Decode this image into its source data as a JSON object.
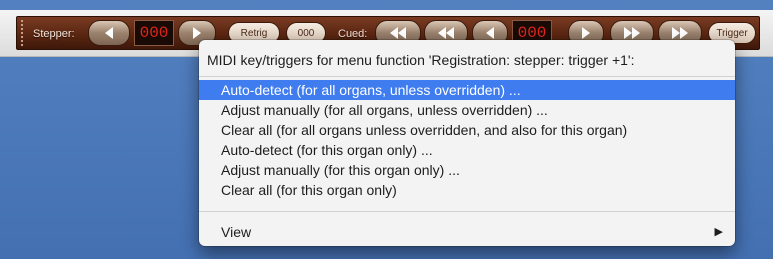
{
  "toolbar": {
    "stepper_label": "Stepper:",
    "stepper_counter": "000",
    "retrig_label": "Retrig",
    "count_label": "000",
    "cued_label": "Cued:",
    "cued_counter": "000",
    "trigger_label": "Trigger"
  },
  "menu": {
    "header": "MIDI key/triggers for menu function 'Registration: stepper: trigger +1':",
    "items": [
      {
        "label": "Auto-detect (for all organs, unless overridden) ..."
      },
      {
        "label": "Adjust manually (for all organs, unless overridden) ..."
      },
      {
        "label": "Clear all (for all organs unless overridden, and also for this organ)"
      },
      {
        "label": "Auto-detect (for this organ only) ..."
      },
      {
        "label": "Adjust manually (for this organ only) ..."
      },
      {
        "label": "Clear all (for this organ only)"
      }
    ],
    "selected_index": 0,
    "view_label": "View",
    "view_arrow_icon": "triangle-right-icon"
  },
  "colors": {
    "desktop": "#4a77b8",
    "strip": "#5a2611",
    "counter_digits": "#e0261c",
    "selection": "#3f7cf0"
  }
}
